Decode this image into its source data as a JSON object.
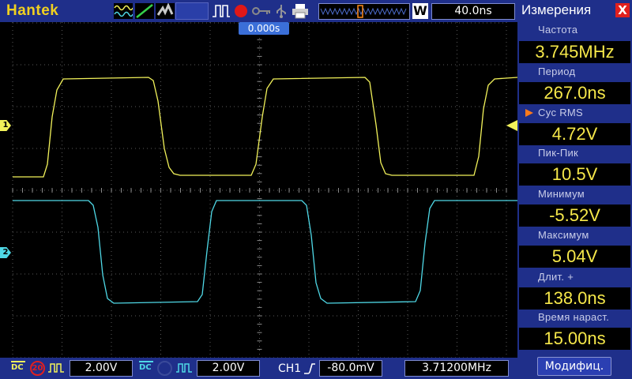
{
  "toolbar": {
    "brand": "Hantek",
    "timebase": "40.0ns",
    "window_btn": "W"
  },
  "trigger": {
    "time": "0.000s"
  },
  "channels": {
    "ch1": {
      "marker": "1",
      "color": "#f2f25a",
      "volts_div": "2.00V",
      "coupling": "DC",
      "bw": "20"
    },
    "ch2": {
      "marker": "2",
      "color": "#4fd8e6",
      "volts_div": "2.00V",
      "coupling": "DC"
    }
  },
  "trigger_bar": {
    "source": "CH1",
    "level": "-80.0mV",
    "freq": "3.71200MHz"
  },
  "panel": {
    "title": "Измерения",
    "close": "X",
    "measurements": [
      {
        "label": "Частота",
        "value": "3.745MHz"
      },
      {
        "label": "Период",
        "value": "267.0ns"
      },
      {
        "label": "Cyc RMS",
        "value": "4.72V"
      },
      {
        "label": "Пик-Пик",
        "value": "10.5V"
      },
      {
        "label": "Минимум",
        "value": "-5.52V"
      },
      {
        "label": "Максимум",
        "value": "5.04V"
      },
      {
        "label": "Длит. +",
        "value": "138.0ns"
      },
      {
        "label": "Время нараст.",
        "value": "15.00ns"
      }
    ],
    "modify_btn": "Модифиц."
  }
}
